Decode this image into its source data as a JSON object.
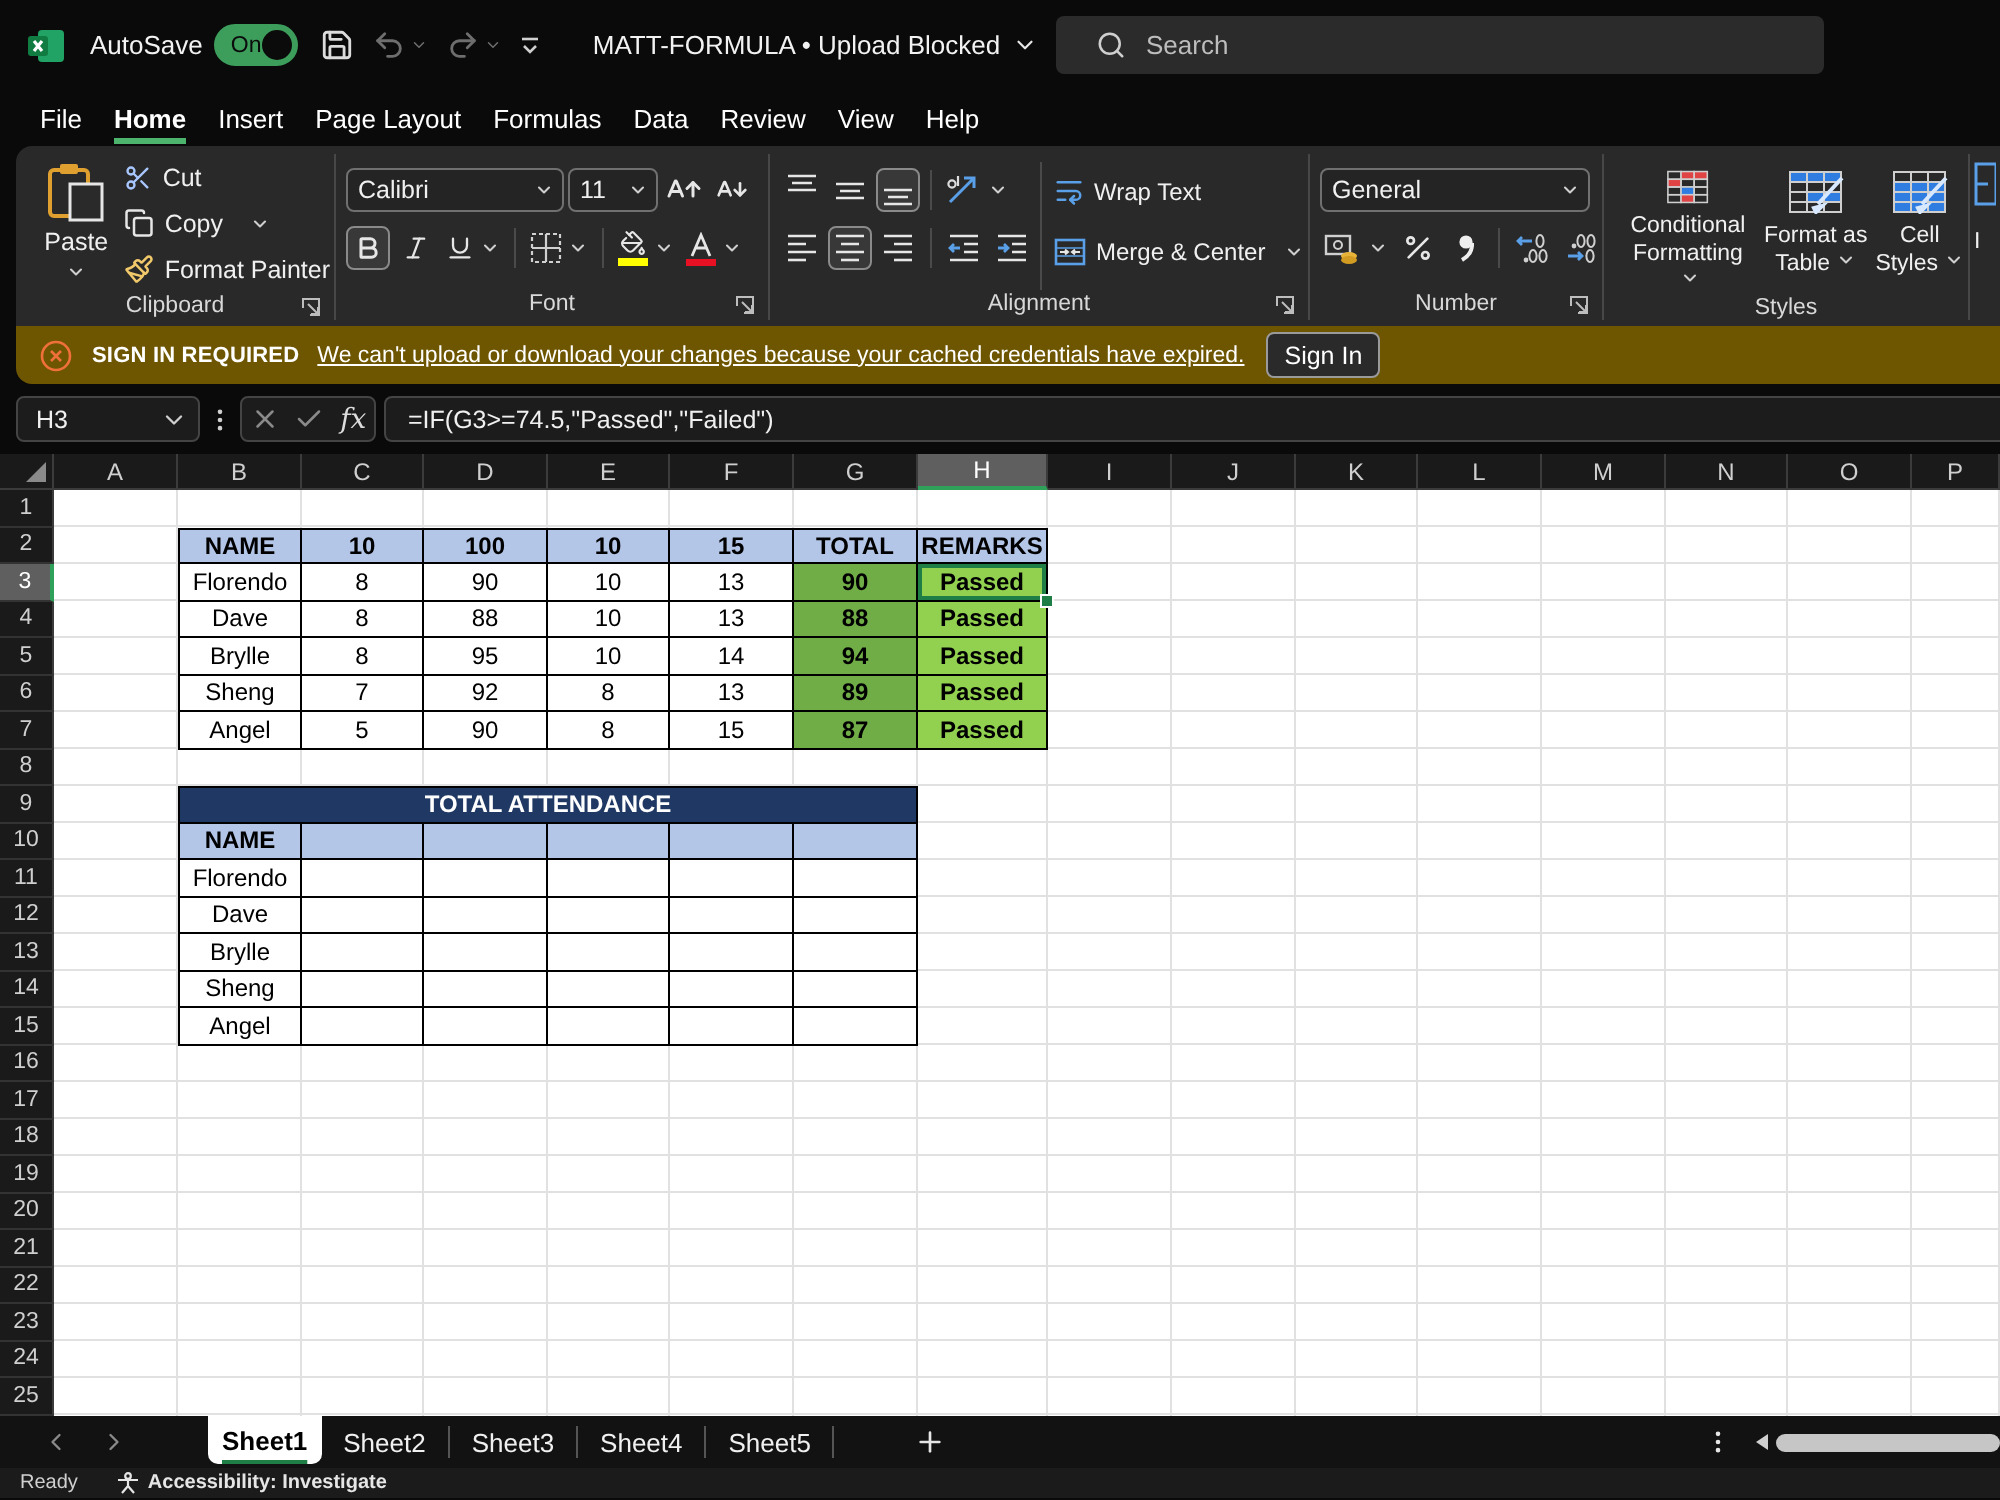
{
  "title_bar": {
    "autosave_label": "AutoSave",
    "autosave_toggle": {
      "label": "On",
      "on": true
    },
    "document_title": "MATT-FORMULA • Upload Blocked",
    "search": {
      "placeholder": "Search"
    }
  },
  "menu_tabs": [
    {
      "label": "File",
      "selected": false
    },
    {
      "label": "Home",
      "selected": true
    },
    {
      "label": "Insert",
      "selected": false
    },
    {
      "label": "Page Layout",
      "selected": false
    },
    {
      "label": "Formulas",
      "selected": false
    },
    {
      "label": "Data",
      "selected": false
    },
    {
      "label": "Review",
      "selected": false
    },
    {
      "label": "View",
      "selected": false
    },
    {
      "label": "Help",
      "selected": false
    }
  ],
  "ribbon": {
    "clipboard": {
      "label": "Clipboard",
      "paste": "Paste",
      "cut": "Cut",
      "copy": "Copy",
      "format_painter": "Format Painter"
    },
    "font": {
      "label": "Font",
      "font_name": "Calibri",
      "font_size": "11",
      "bold": true,
      "italic": false,
      "underline": false
    },
    "alignment": {
      "label": "Alignment",
      "vertical": [
        {
          "kind": "top",
          "selected": false
        },
        {
          "kind": "middle",
          "selected": false
        },
        {
          "kind": "bottom",
          "selected": true
        }
      ],
      "horizontal": [
        {
          "kind": "left",
          "selected": false
        },
        {
          "kind": "center",
          "selected": true
        },
        {
          "kind": "right",
          "selected": false
        }
      ],
      "wrap_text": "Wrap Text",
      "merge": "Merge & Center"
    },
    "number": {
      "label": "Number",
      "format": "General"
    },
    "styles": {
      "label": "Styles",
      "buttons": [
        {
          "kind": "conditional",
          "label": "Conditional\nFormatting"
        },
        {
          "kind": "table",
          "label": "Format as\nTable"
        },
        {
          "kind": "cell",
          "label": "Cell\nStyles"
        }
      ]
    },
    "cut_off_button": {
      "label": "I"
    }
  },
  "notification": {
    "title": "SIGN IN REQUIRED",
    "message": "We can't upload or download your changes because your cached credentials have expired.",
    "button": "Sign In"
  },
  "formula_bar": {
    "name_box": "H3",
    "function_button": "fx",
    "formula": "=IF(G3>=74.5,\"Passed\",\"Failed\")"
  },
  "sheet": {
    "columns": [
      {
        "label": "A",
        "selected": false
      },
      {
        "label": "B",
        "selected": false
      },
      {
        "label": "C",
        "selected": false
      },
      {
        "label": "D",
        "selected": false
      },
      {
        "label": "E",
        "selected": false
      },
      {
        "label": "F",
        "selected": false
      },
      {
        "label": "G",
        "selected": false
      },
      {
        "label": "H",
        "selected": true
      },
      {
        "label": "I",
        "selected": false
      },
      {
        "label": "J",
        "selected": false
      },
      {
        "label": "K",
        "selected": false
      },
      {
        "label": "L",
        "selected": false
      },
      {
        "label": "M",
        "selected": false
      },
      {
        "label": "N",
        "selected": false
      },
      {
        "label": "O",
        "selected": false
      },
      {
        "label": "P",
        "selected": false
      }
    ],
    "rows": [
      {
        "label": "1",
        "selected": false
      },
      {
        "label": "2",
        "selected": false
      },
      {
        "label": "3",
        "selected": true
      },
      {
        "label": "4",
        "selected": false
      },
      {
        "label": "5",
        "selected": false
      },
      {
        "label": "6",
        "selected": false
      },
      {
        "label": "7",
        "selected": false
      },
      {
        "label": "8",
        "selected": false
      },
      {
        "label": "9",
        "selected": false
      },
      {
        "label": "10",
        "selected": false
      },
      {
        "label": "11",
        "selected": false
      },
      {
        "label": "12",
        "selected": false
      },
      {
        "label": "13",
        "selected": false
      },
      {
        "label": "14",
        "selected": false
      },
      {
        "label": "15",
        "selected": false
      },
      {
        "label": "16",
        "selected": false
      },
      {
        "label": "17",
        "selected": false
      },
      {
        "label": "18",
        "selected": false
      },
      {
        "label": "19",
        "selected": false
      },
      {
        "label": "20",
        "selected": false
      },
      {
        "label": "21",
        "selected": false
      },
      {
        "label": "22",
        "selected": false
      },
      {
        "label": "23",
        "selected": false
      },
      {
        "label": "24",
        "selected": false
      },
      {
        "label": "25",
        "selected": false
      }
    ],
    "score_table": {
      "header": [
        "NAME",
        "10",
        "100",
        "10",
        "15",
        "TOTAL",
        "REMARKS"
      ],
      "rows": [
        {
          "name": "Florendo",
          "scores": [
            "8",
            "90",
            "10",
            "13"
          ],
          "total": "90",
          "remarks": "Passed"
        },
        {
          "name": "Dave",
          "scores": [
            "8",
            "88",
            "10",
            "13"
          ],
          "total": "88",
          "remarks": "Passed"
        },
        {
          "name": "Brylle",
          "scores": [
            "8",
            "95",
            "10",
            "14"
          ],
          "total": "94",
          "remarks": "Passed"
        },
        {
          "name": "Sheng",
          "scores": [
            "7",
            "92",
            "8",
            "13"
          ],
          "total": "89",
          "remarks": "Passed"
        },
        {
          "name": "Angel",
          "scores": [
            "5",
            "90",
            "8",
            "15"
          ],
          "total": "87",
          "remarks": "Passed"
        }
      ]
    },
    "attendance_table": {
      "title": "TOTAL ATTENDANCE",
      "header": "NAME",
      "names": [
        "Florendo",
        "Dave",
        "Brylle",
        "Sheng",
        "Angel"
      ]
    }
  },
  "sheet_tabs": [
    {
      "label": "Sheet1",
      "selected": true
    },
    {
      "label": "Sheet2",
      "selected": false
    },
    {
      "label": "Sheet3",
      "selected": false
    },
    {
      "label": "Sheet4",
      "selected": false
    },
    {
      "label": "Sheet5",
      "selected": false
    }
  ],
  "status_bar": {
    "status": "Ready",
    "accessibility": "Accessibility: Investigate"
  }
}
